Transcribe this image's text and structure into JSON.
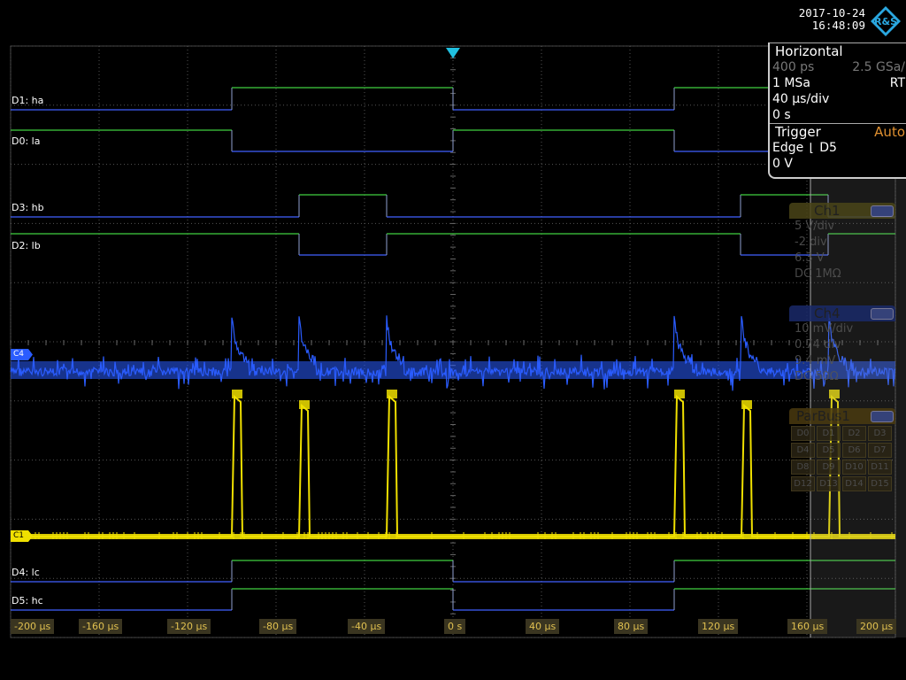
{
  "header": {
    "date": "2017-10-24",
    "time": "16:48:09",
    "logo_text": "R&S"
  },
  "horizontal": {
    "title": "Horizontal",
    "resolution": "400 ps",
    "sample_rate": "2.5 GSa/",
    "record_length": "1 MSa",
    "mode": "RT",
    "time_scale": "40 µs/div",
    "position": "0 s"
  },
  "trigger": {
    "title": "Trigger",
    "mode": "Auto",
    "type": "Edge",
    "source": "D5",
    "level": "0 V"
  },
  "ch1_box": {
    "title": "Ch1",
    "scale": "5 V/div",
    "offset_div": "-2 div",
    "offset": "6.3 V",
    "coupling": "DC 1MΩ"
  },
  "ch4_box": {
    "title": "Ch4",
    "scale": "10 mV/div",
    "offset_div": "0.74 div",
    "offset": "9.4 mV",
    "coupling": "DC 50Ω"
  },
  "parbus": {
    "title": "ParBus1",
    "bits": [
      "D0",
      "D1",
      "D2",
      "D3",
      "D4",
      "D5",
      "D6",
      "D7",
      "D8",
      "D9",
      "D10",
      "D11",
      "D12",
      "D13",
      "D14",
      "D15"
    ]
  },
  "digital_labels": {
    "d1": "D1: ha",
    "d0": "D0: la",
    "d3": "D3: hb",
    "d2": "D2: lb",
    "d4": "D4: lc",
    "d5": "D5: hc"
  },
  "channel_markers": {
    "c4": "C4",
    "c1": "C1"
  },
  "x_axis": {
    "ticks": [
      "-200 µs",
      "-160 µs",
      "-120 µs",
      "-80 µs",
      "-40 µs",
      "0 s",
      "40 µs",
      "80 µs",
      "120 µs",
      "160 µs",
      "200 µs"
    ]
  },
  "colors": {
    "ch1": "#f0e000",
    "ch4": "#2a5cff",
    "digital_high": "#40d040",
    "digital_low": "#4060ff",
    "grid": "#555555",
    "trigger_marker": "#20c0e0"
  }
}
